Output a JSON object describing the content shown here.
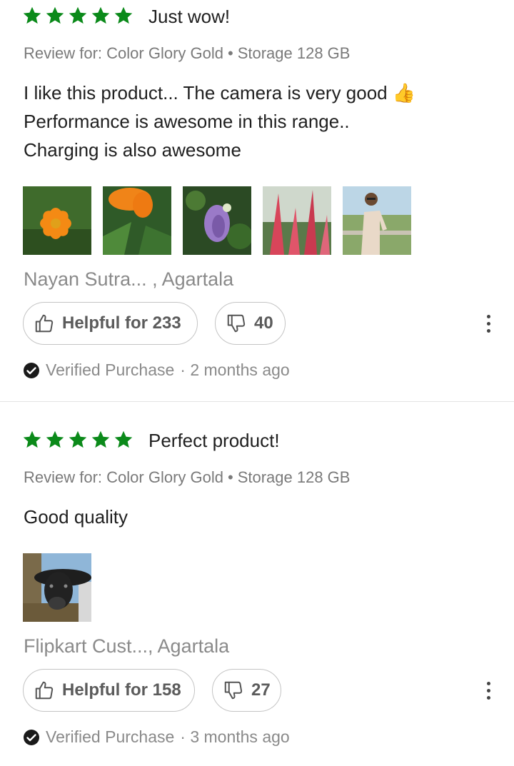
{
  "colors": {
    "star": "#0b8a1a",
    "text": "#1f1f1f",
    "muted": "#8a8a8a",
    "border": "#c4c4c4"
  },
  "reviews": [
    {
      "rating": 5,
      "title": "Just wow!",
      "variant_prefix": "Review for: Color Glory Gold",
      "variant_storage": "Storage 128 GB",
      "body_lines": [
        "I like this product... The camera is very good 👍",
        "Performance is awesome in this range..",
        "Charging is also awesome"
      ],
      "photos": [
        "orange-flower-photo",
        "orange-flower-leaves-photo",
        "purple-flower-photo",
        "pink-flower-buds-photo",
        "person-photo"
      ],
      "author": "Nayan Sutra... , Agartala",
      "helpful_label": "Helpful for 233",
      "dislike_count": "40",
      "verified_label": "Verified Purchase",
      "time_ago": "· 2 months ago"
    },
    {
      "rating": 5,
      "title": "Perfect product!",
      "variant_prefix": "Review for: Color Glory Gold",
      "variant_storage": "Storage 128 GB",
      "body_lines": [
        "Good quality"
      ],
      "photos": [
        "cow-photo"
      ],
      "author": "Flipkart Cust..., Agartala",
      "helpful_label": "Helpful for 158",
      "dislike_count": "27",
      "verified_label": "Verified Purchase",
      "time_ago": "· 3 months ago"
    }
  ]
}
